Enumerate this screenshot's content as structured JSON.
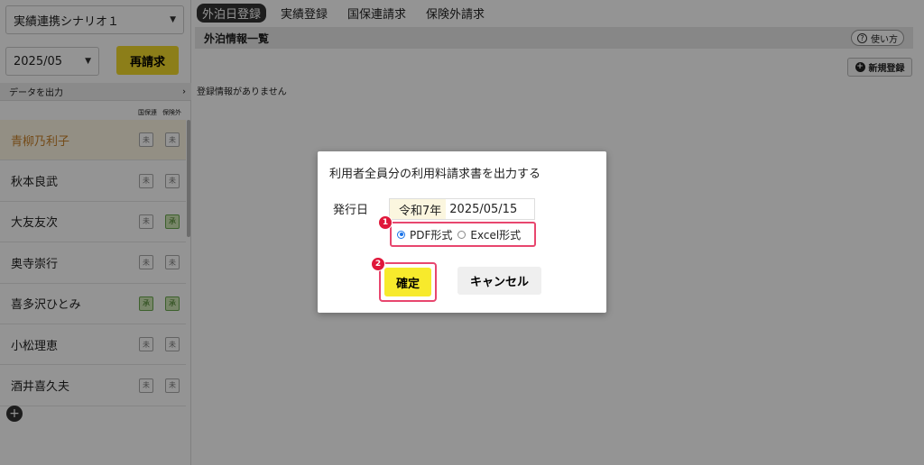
{
  "sidebar": {
    "scenario": "実績連携シナリオ１",
    "month": "2025/05",
    "rebill_label": "再請求",
    "export_label": "データを出力",
    "col_headers": [
      "国保連",
      "保険外"
    ],
    "users": [
      {
        "name": "青柳乃利子",
        "b1": "未",
        "b2": "未"
      },
      {
        "name": "秋本良武",
        "b1": "未",
        "b2": "未"
      },
      {
        "name": "大友友次",
        "b1": "未",
        "b2": "承"
      },
      {
        "name": "奥寺崇行",
        "b1": "未",
        "b2": "未"
      },
      {
        "name": "喜多沢ひとみ",
        "b1": "承",
        "b2": "承"
      },
      {
        "name": "小松理恵",
        "b1": "未",
        "b2": "未"
      },
      {
        "name": "酒井喜久夫",
        "b1": "未",
        "b2": "未"
      }
    ],
    "add_glyph": "+"
  },
  "tabs": [
    "外泊日登録",
    "実績登録",
    "国保連請求",
    "保険外請求"
  ],
  "main": {
    "section_title": "外泊情報一覧",
    "help_label": "使い方",
    "help_glyph": "?",
    "new_label": "新規登録",
    "new_glyph": "+",
    "empty_message": "登録情報がありません"
  },
  "modal": {
    "title": "利用者全員分の利用料請求書を出力する",
    "date_label": "発行日",
    "era": "令和7年",
    "date_value": "2025/05/15",
    "format_pdf": "PDF形式",
    "format_excel": "Excel形式",
    "selected_format": "pdf",
    "ok_label": "確定",
    "cancel_label": "キャンセル",
    "step1": "1",
    "step2": "2"
  },
  "icons": {
    "chevron": "chevron-down-icon",
    "chevron_right": "chevron-right-icon"
  },
  "colors": {
    "accent_yellow": "#f7ea2c",
    "highlight_pink": "#e8466e",
    "active_user": "#c9822b",
    "step_red": "#e0173a"
  }
}
